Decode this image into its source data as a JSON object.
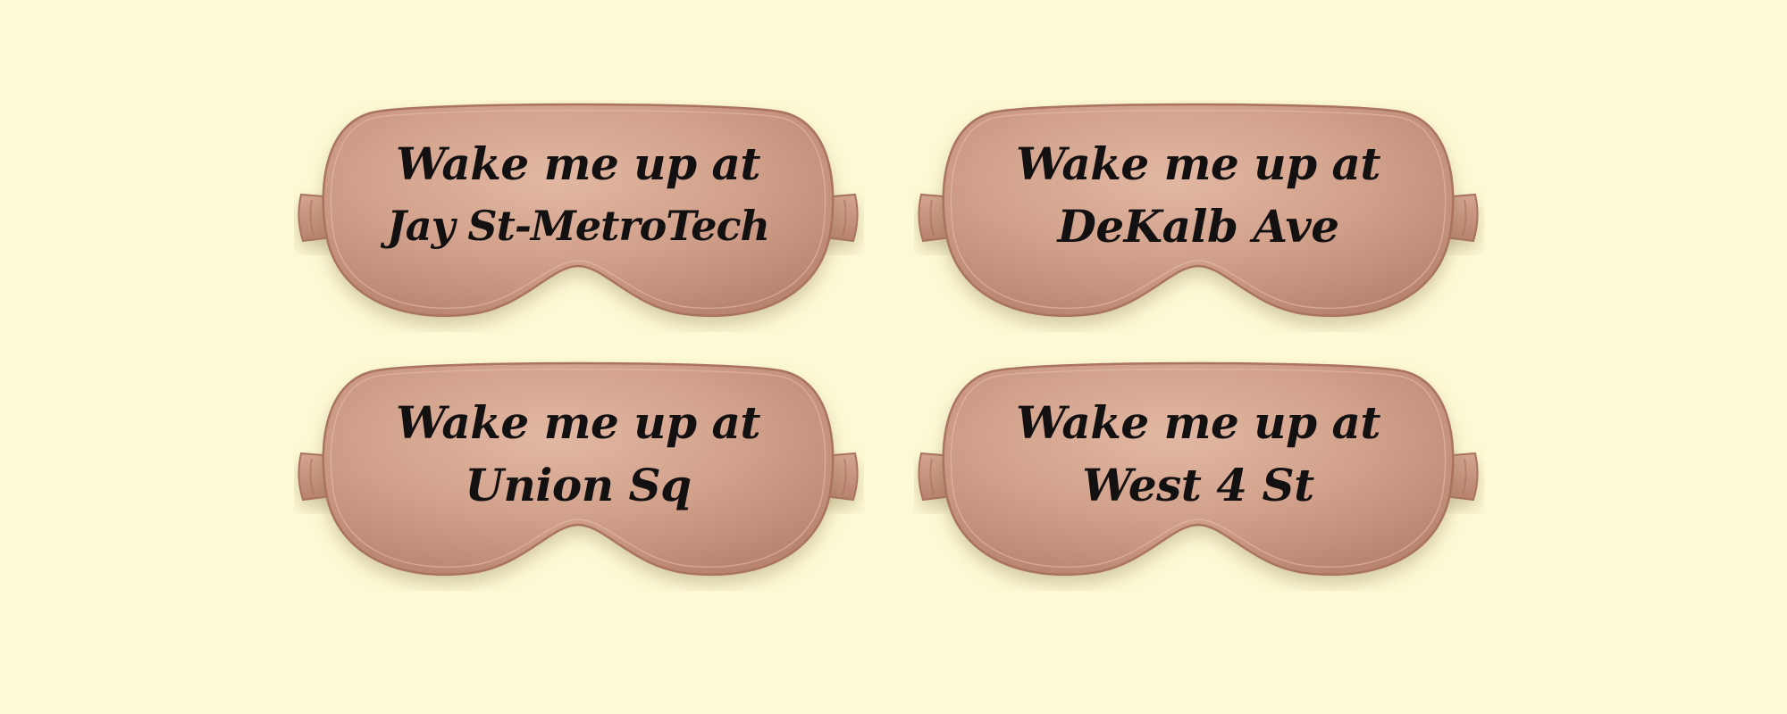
{
  "background_color": "#fdf9d5",
  "mask_color": "#cf9e88",
  "masks": [
    {
      "line1": "Wake me up at",
      "line2": "Jay St-MetroTech"
    },
    {
      "line1": "Wake me up at",
      "line2": "DeKalb Ave"
    },
    {
      "line1": "Wake me up at",
      "line2": "Union Sq"
    },
    {
      "line1": "Wake me up at",
      "line2": "West 4 St"
    }
  ]
}
